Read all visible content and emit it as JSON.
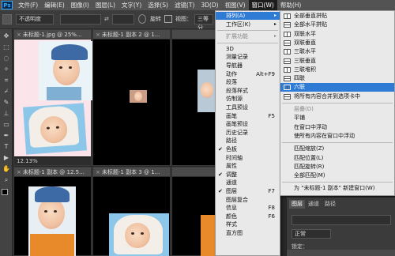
{
  "menubar": {
    "logo": "Ps",
    "items": [
      "文件(F)",
      "编辑(E)",
      "图像(I)",
      "图层(L)",
      "文字(Y)",
      "选择(S)",
      "滤镜(T)",
      "3D(D)",
      "视图(V)",
      "窗口(W)",
      "帮助(H)"
    ]
  },
  "options": {
    "style_value": "不透明度",
    "width_label": "宽：",
    "height_label": "高：",
    "adjust_label": "调整边缘...",
    "rotate_label": "旋转",
    "view_label": "视图：",
    "view_value": "三等分"
  },
  "documents": [
    {
      "tab": "未标题-1.jpg @ 25%...",
      "status": "12.13%"
    },
    {
      "tab": "未标题-1 副本 2 @ 1..."
    },
    {
      "tab": "未标题-1 副本 @ 12.5..."
    },
    {
      "tab": "未标题-1 副本 3 @ 1..."
    }
  ],
  "window_menu": {
    "items": [
      {
        "label": "排列(A)",
        "arrow": "▸",
        "highlight": true
      },
      {
        "label": "工作区(K)",
        "arrow": "▸"
      },
      {
        "label": "扩展功能",
        "arrow": "▸",
        "disabled": true
      },
      {
        "label": "3D"
      },
      {
        "label": "测量记录"
      },
      {
        "label": "导航器"
      },
      {
        "label": "动作",
        "shortcut": "Alt+F9"
      },
      {
        "label": "段落"
      },
      {
        "label": "段落样式"
      },
      {
        "label": "仿制源"
      },
      {
        "label": "工具预设"
      },
      {
        "label": "画笔",
        "shortcut": "F5"
      },
      {
        "label": "画笔预设"
      },
      {
        "label": "历史记录"
      },
      {
        "label": "路径"
      },
      {
        "label": "色板",
        "checked": "✔"
      },
      {
        "label": "时间轴"
      },
      {
        "label": "属性"
      },
      {
        "label": "调整",
        "checked": "✔"
      },
      {
        "label": "通道"
      },
      {
        "label": "图层",
        "shortcut": "F7",
        "checked": "✔"
      },
      {
        "label": "图层复合"
      },
      {
        "label": "信息",
        "shortcut": "F8"
      },
      {
        "label": "颜色",
        "shortcut": "F6"
      },
      {
        "label": "样式"
      },
      {
        "label": "直方图"
      }
    ]
  },
  "arrange_submenu": {
    "items": [
      {
        "label": "全部垂直拼贴"
      },
      {
        "label": "全部水平拼贴"
      },
      {
        "label": "双联水平"
      },
      {
        "label": "双联垂直"
      },
      {
        "label": "三联水平"
      },
      {
        "label": "三联垂直"
      },
      {
        "label": "三联堆积"
      },
      {
        "label": "四联"
      },
      {
        "label": "六联",
        "highlight": true
      },
      {
        "label": "将所有内容合并到选项卡中"
      },
      {
        "label": "层叠(D)",
        "disabled": true
      },
      {
        "label": "平铺"
      },
      {
        "label": "在窗口中浮动"
      },
      {
        "label": "使所有内容在窗口中浮动"
      },
      {
        "label": "匹配缩放(Z)"
      },
      {
        "label": "匹配位置(L)"
      },
      {
        "label": "匹配旋转(R)"
      },
      {
        "label": "全部匹配(M)"
      },
      {
        "label": "为 \"未标题-1 副本\" 新建窗口(W)"
      }
    ]
  },
  "panel": {
    "tabs": [
      "图层",
      "通道",
      "路径"
    ],
    "mode_value": "正常",
    "lock_label": "锁定："
  },
  "colors": {
    "highlight": "#2e7bd6",
    "menu_bg": "#e9e9e9"
  }
}
